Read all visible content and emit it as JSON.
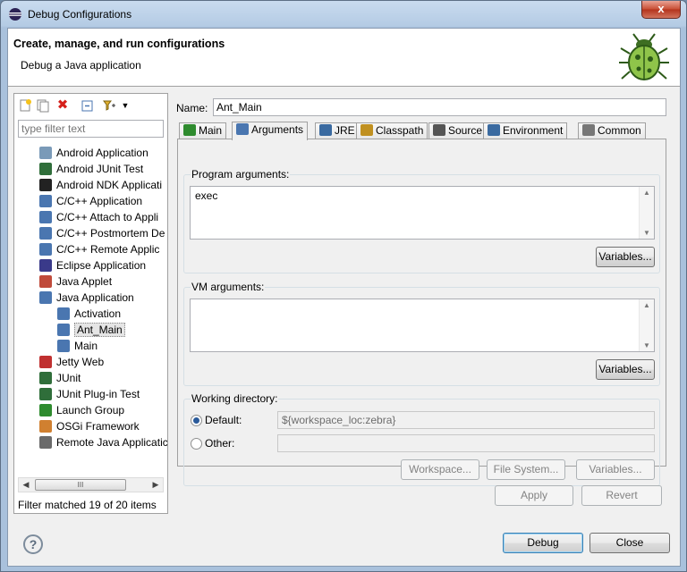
{
  "window": {
    "title": "Debug Configurations",
    "close_glyph": "x"
  },
  "banner": {
    "title": "Create, manage, and run configurations",
    "subtitle": "Debug a Java application"
  },
  "left": {
    "filter_placeholder": "type filter text",
    "status": "Filter matched 19 of 20 items",
    "scroll_thumb": "III",
    "tree": [
      {
        "label": "Android Application",
        "icon": "android-app-icon",
        "color": "#7a9ab8"
      },
      {
        "label": "Android JUnit Test",
        "icon": "junit-icon",
        "color": "#2f6e3a"
      },
      {
        "label": "Android NDK Applicati",
        "icon": "ndk-icon",
        "color": "#222222"
      },
      {
        "label": "C/C++ Application",
        "icon": "c-app-icon",
        "color": "#4a76b0"
      },
      {
        "label": "C/C++ Attach to Appli",
        "icon": "c-app-icon",
        "color": "#4a76b0"
      },
      {
        "label": "C/C++ Postmortem De",
        "icon": "c-app-icon",
        "color": "#4a76b0"
      },
      {
        "label": "C/C++ Remote Applic",
        "icon": "c-app-icon",
        "color": "#4a76b0"
      },
      {
        "label": "Eclipse Application",
        "icon": "eclipse-icon",
        "color": "#3a3a8a"
      },
      {
        "label": "Java Applet",
        "icon": "applet-icon",
        "color": "#c04a3a"
      },
      {
        "label": "Java Application",
        "icon": "java-app-icon",
        "color": "#4a76b0"
      },
      {
        "label": "Activation",
        "icon": "java-config-icon",
        "color": "#4a76b0",
        "child": true
      },
      {
        "label": "Ant_Main",
        "icon": "java-config-icon",
        "color": "#4a76b0",
        "child": true,
        "selected": true
      },
      {
        "label": "Main",
        "icon": "java-config-icon",
        "color": "#4a76b0",
        "child": true
      },
      {
        "label": "Jetty Web",
        "icon": "jetty-icon",
        "color": "#c03030"
      },
      {
        "label": "JUnit",
        "icon": "junit-icon",
        "color": "#2f6e3a"
      },
      {
        "label": "JUnit Plug-in Test",
        "icon": "junit-plugin-icon",
        "color": "#2f6e3a"
      },
      {
        "label": "Launch Group",
        "icon": "launch-group-icon",
        "color": "#2e8b2e"
      },
      {
        "label": "OSGi Framework",
        "icon": "osgi-icon",
        "color": "#d08030"
      },
      {
        "label": "Remote Java Applicatic",
        "icon": "remote-java-icon",
        "color": "#6a6a6a"
      }
    ]
  },
  "config": {
    "name_label": "Name:",
    "name_value": "Ant_Main",
    "tabs": [
      {
        "label": "Main",
        "icon": "main-tab-icon"
      },
      {
        "label": "Arguments",
        "icon": "arguments-tab-icon",
        "active": true
      },
      {
        "label": "JRE",
        "icon": "jre-tab-icon"
      },
      {
        "label": "Classpath",
        "icon": "classpath-tab-icon"
      },
      {
        "label": "Source",
        "icon": "source-tab-icon"
      },
      {
        "label": "Environment",
        "icon": "environment-tab-icon"
      },
      {
        "label": "Common",
        "icon": "common-tab-icon"
      }
    ],
    "program_args_label": "Program arguments:",
    "program_args_value": "exec",
    "vm_args_label": "VM arguments:",
    "vm_args_value": "",
    "variables_label": "Variables...",
    "working_dir_label": "Working directory:",
    "default_label": "Default:",
    "default_value": "${workspace_loc:zebra}",
    "other_label": "Other:",
    "other_value": "",
    "workspace_btn": "Workspace...",
    "filesystem_btn": "File System...",
    "variables_btn": "Variables..."
  },
  "buttons": {
    "apply": "Apply",
    "revert": "Revert",
    "debug": "Debug",
    "close": "Close",
    "help": "?"
  }
}
